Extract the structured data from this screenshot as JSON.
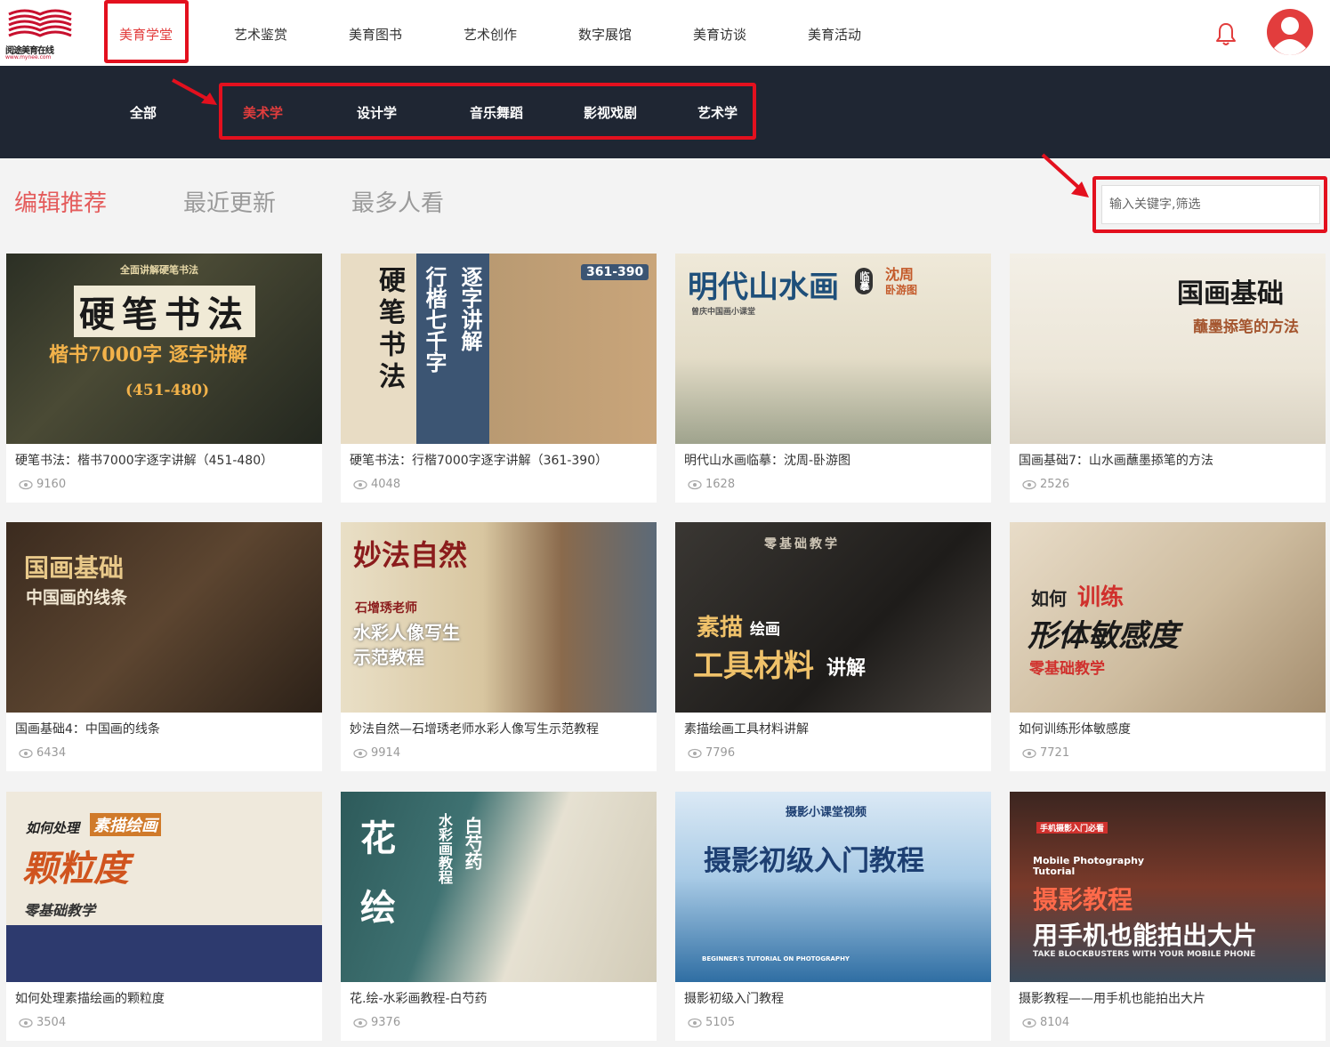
{
  "logo": {
    "name": "阅途美育在线",
    "url": "www.mynee.com"
  },
  "nav": {
    "items": [
      "美育学堂",
      "艺术鉴赏",
      "美育图书",
      "艺术创作",
      "数字展馆",
      "美育访谈",
      "美育活动"
    ],
    "active_index": 0
  },
  "subnav": {
    "items": [
      "全部",
      "美术学",
      "设计学",
      "音乐舞蹈",
      "影视戏剧",
      "艺术学"
    ],
    "active_index": 1
  },
  "tabs": {
    "items": [
      "编辑推荐",
      "最近更新",
      "最多人看"
    ],
    "active_index": 0
  },
  "search": {
    "placeholder": "输入关键字,筛选"
  },
  "cards": [
    {
      "title": "硬笔书法：楷书7000字逐字讲解（451-480）",
      "views": "9160",
      "thumb_text": [
        "全面讲解硬笔书法",
        "硬笔书法",
        "楷书7000字 逐字讲解",
        "(451-480)"
      ]
    },
    {
      "title": "硬笔书法：行楷7000字逐字讲解（361-390）",
      "views": "4048",
      "thumb_text": [
        "硬笔书法",
        "行楷七千字",
        "逐字讲解",
        "361-390"
      ]
    },
    {
      "title": "明代山水画临摹：沈周-卧游图",
      "views": "1628",
      "thumb_text": [
        "明代山水画",
        "临摹",
        "沈周",
        "卧游图",
        "曾庆中国画小课堂"
      ]
    },
    {
      "title": "国画基础7：山水画蘸墨掭笔的方法",
      "views": "2526",
      "thumb_text": [
        "国画基础",
        "蘸墨掭笔的方法"
      ]
    },
    {
      "title": "国画基础4：中国画的线条",
      "views": "6434",
      "thumb_text": [
        "国画基础",
        "中国画的线条"
      ]
    },
    {
      "title": "妙法自然—石增琇老师水彩人像写生示范教程",
      "views": "9914",
      "thumb_text": [
        "妙法自然",
        "石增琇老师",
        "水彩人像写生",
        "示范教程"
      ]
    },
    {
      "title": "素描绘画工具材料讲解",
      "views": "7796",
      "thumb_text": [
        "零基础教学",
        "素描",
        "绘画",
        "工具材料",
        "讲解"
      ]
    },
    {
      "title": "如何训练形体敏感度",
      "views": "7721",
      "thumb_text": [
        "如何",
        "训练",
        "形体敏感度",
        "零基础教学"
      ]
    },
    {
      "title": "如何处理素描绘画的颗粒度",
      "views": "3504",
      "thumb_text": [
        "如何处理",
        "素描绘画",
        "颗粒度",
        "零基础教学"
      ]
    },
    {
      "title": "花.绘-水彩画教程-白芍药",
      "views": "9376",
      "thumb_text": [
        "花",
        "绘",
        "水彩画教程",
        "白芍药"
      ]
    },
    {
      "title": "摄影初级入门教程",
      "views": "5105",
      "thumb_text": [
        "摄影小课堂视频",
        "摄影初级入门教程",
        "BEGINNER'S TUTORIAL ON PHOTOGRAPHY"
      ]
    },
    {
      "title": "摄影教程——用手机也能拍出大片",
      "views": "8104",
      "thumb_text": [
        "手机摄影入门必看",
        "Mobile Photography Tutorial",
        "摄影教程",
        "用手机也能拍出大片",
        "TAKE BLOCKBUSTERS WITH YOUR MOBILE PHONE"
      ]
    }
  ],
  "colors": {
    "accent": "#e23d3d",
    "highlight_box": "#e3101e",
    "subnav_bg": "#1f2633"
  }
}
